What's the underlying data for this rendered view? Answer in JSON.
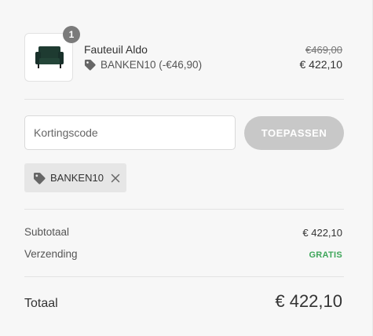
{
  "cart": {
    "item": {
      "quantity": "1",
      "name": "Fauteuil Aldo",
      "discount_label": "BANKEN10 (-€46,90)",
      "original_price": "€469,00",
      "price": "€ 422,10",
      "image_icon": "armchair"
    }
  },
  "discount": {
    "input_placeholder": "Kortingscode",
    "input_value": "",
    "apply_label": "TOEPASSEN",
    "applied_code": "BANKEN10"
  },
  "summary": {
    "subtotal_label": "Subtotaal",
    "subtotal_value": "€ 422,10",
    "shipping_label": "Verzending",
    "shipping_value": "GRATIS",
    "total_label": "Totaal",
    "total_value": "€ 422,10"
  },
  "colors": {
    "free_shipping": "#3ea65a",
    "apply_button_bg": "#c8c8c8",
    "armchair": "#1e3b31"
  }
}
